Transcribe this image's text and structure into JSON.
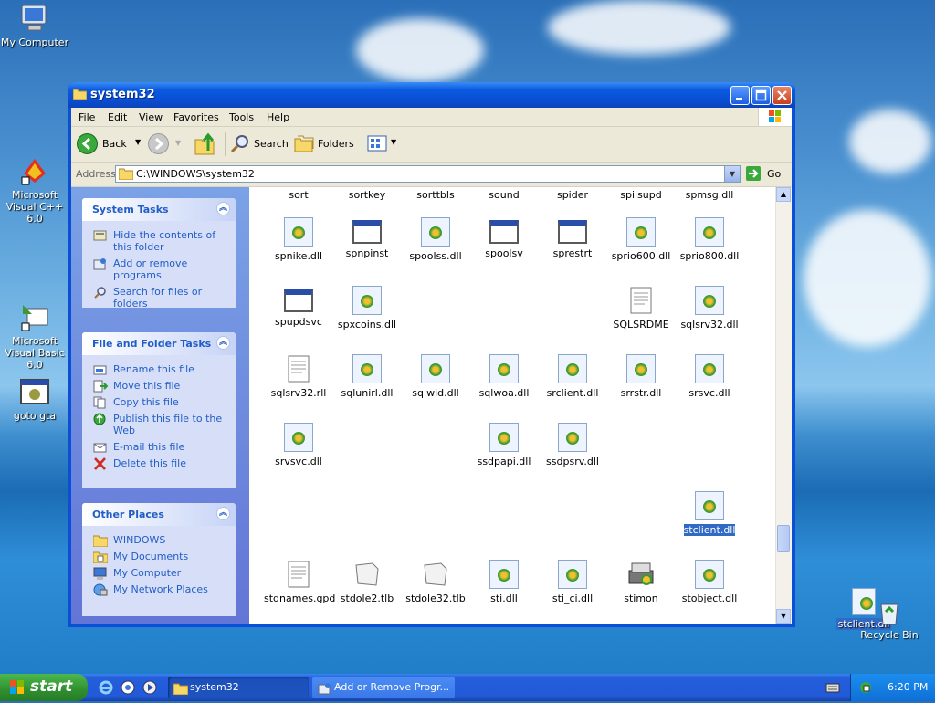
{
  "desktop": {
    "icons": [
      {
        "label": "My Computer",
        "icon": "my-computer-icon"
      },
      {
        "label": "Microsoft Visual C++ 6.0",
        "icon": "visual-cpp-icon"
      },
      {
        "label": "Microsoft Visual Basic 6.0",
        "icon": "visual-basic-icon"
      },
      {
        "label": "goto gta",
        "icon": "shortcut-app-icon"
      },
      {
        "label": "stclient.dll",
        "icon": "dll-file-icon"
      },
      {
        "label": "Recycle Bin",
        "icon": "recycle-bin-icon"
      }
    ]
  },
  "window": {
    "title": "system32",
    "menu": [
      "File",
      "Edit",
      "View",
      "Favorites",
      "Tools",
      "Help"
    ],
    "toolbar": {
      "back": "Back",
      "search": "Search",
      "folders": "Folders"
    },
    "address": {
      "label": "Address",
      "value": "C:\\WINDOWS\\system32",
      "go": "Go"
    }
  },
  "tasks": {
    "system": {
      "title": "System Tasks",
      "items": [
        "Hide the contents of this folder",
        "Add or remove programs",
        "Search for files or folders"
      ]
    },
    "file_folder": {
      "title": "File and Folder Tasks",
      "items": [
        "Rename this file",
        "Move this file",
        "Copy this file",
        "Publish this file to the Web",
        "E-mail this file",
        "Delete this file"
      ]
    },
    "other": {
      "title": "Other Places",
      "items": [
        "WINDOWS",
        "My Documents",
        "My Computer",
        "My Network Places"
      ]
    }
  },
  "files": {
    "top_row": [
      "sort",
      "sortkey",
      "sorttbls",
      "sound",
      "spider",
      "spiisupd",
      "spmsg.dll"
    ],
    "items": [
      {
        "name": "spnike.dll",
        "type": "dll"
      },
      {
        "name": "spnpinst",
        "type": "exe"
      },
      {
        "name": "spoolss.dll",
        "type": "dll"
      },
      {
        "name": "spoolsv",
        "type": "exe"
      },
      {
        "name": "sprestrt",
        "type": "exe"
      },
      {
        "name": "sprio600.dll",
        "type": "dll"
      },
      {
        "name": "sprio800.dll",
        "type": "dll"
      },
      {
        "name": "spupdsvc",
        "type": "exe"
      },
      {
        "name": "spxcoins.dll",
        "type": "dll"
      },
      {
        "name": "SQLSRDME",
        "type": "doc"
      },
      {
        "name": "sqlsrv32.dll",
        "type": "dll"
      },
      {
        "name": "sqlsrv32.rll",
        "type": "doc"
      },
      {
        "name": "sqlunirl.dll",
        "type": "dll"
      },
      {
        "name": "sqlwid.dll",
        "type": "dll"
      },
      {
        "name": "sqlwoa.dll",
        "type": "dll"
      },
      {
        "name": "srclient.dll",
        "type": "dll"
      },
      {
        "name": "srrstr.dll",
        "type": "dll"
      },
      {
        "name": "srsvc.dll",
        "type": "dll"
      },
      {
        "name": "srvsvc.dll",
        "type": "dll"
      },
      {
        "name": "ssdpapi.dll",
        "type": "dll"
      },
      {
        "name": "ssdpsrv.dll",
        "type": "dll"
      },
      {
        "name": "stclient.dll",
        "type": "dll",
        "selected": true
      },
      {
        "name": "stdnames.gpd",
        "type": "doc"
      },
      {
        "name": "stdole2.tlb",
        "type": "tlb"
      },
      {
        "name": "stdole32.tlb",
        "type": "tlb"
      },
      {
        "name": "sti.dll",
        "type": "dll"
      },
      {
        "name": "sti_ci.dll",
        "type": "dll"
      },
      {
        "name": "stimon",
        "type": "exe"
      },
      {
        "name": "stobject.dll",
        "type": "dll"
      }
    ]
  },
  "taskbar": {
    "start": "start",
    "buttons": [
      "system32",
      "Add or Remove Progr..."
    ],
    "clock": "6:20 PM"
  },
  "colors": {
    "xp_blue": "#0a4ed4",
    "task_link": "#215dc6",
    "selection": "#316ac5"
  }
}
